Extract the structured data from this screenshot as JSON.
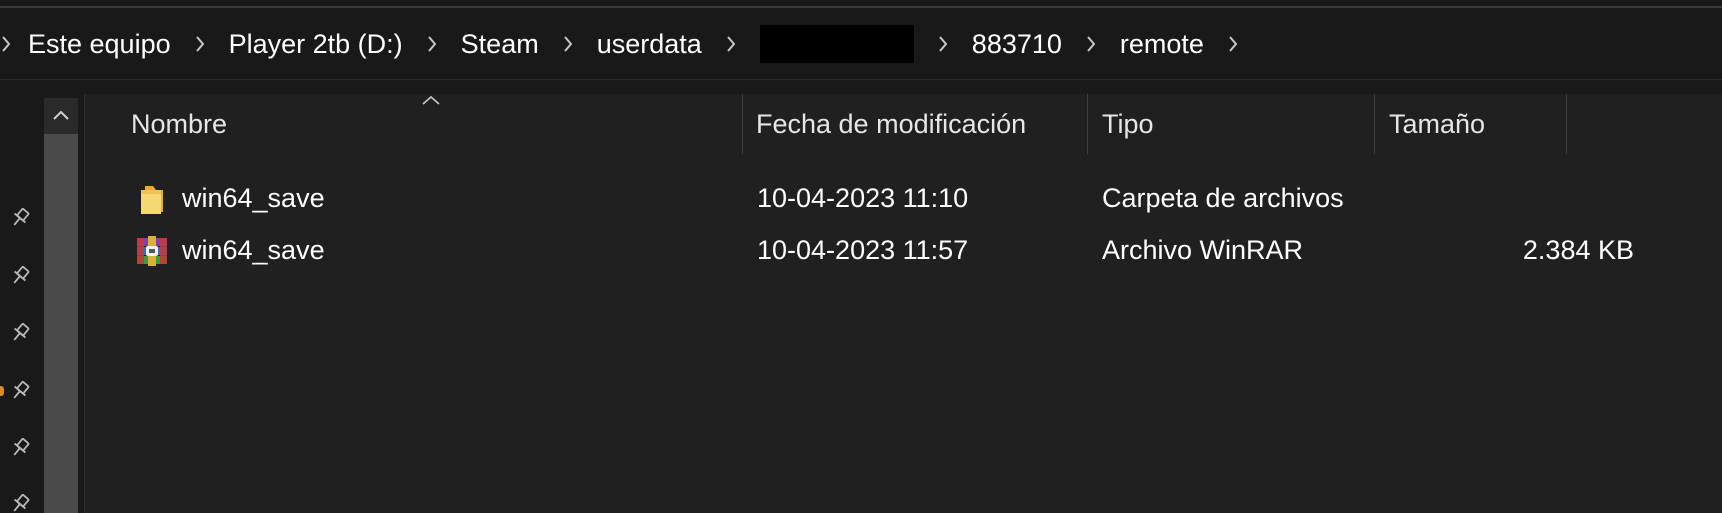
{
  "breadcrumb": {
    "items": [
      "Este equipo",
      "Player 2tb (D:)",
      "Steam",
      "userdata",
      "883710",
      "remote"
    ]
  },
  "columns": {
    "name": "Nombre",
    "modified": "Fecha de modificación",
    "type": "Tipo",
    "size": "Tamaño"
  },
  "files": [
    {
      "icon": "folder-icon",
      "name": "win64_save",
      "modified": "10-04-2023 11:10",
      "type": "Carpeta de archivos",
      "size": ""
    },
    {
      "icon": "winrar-archive-icon",
      "name": "win64_save",
      "modified": "10-04-2023 11:57",
      "type": "Archivo WinRAR",
      "size": "2.384 KB"
    }
  ],
  "colors": {
    "background": "#191919",
    "content_background": "#202020",
    "text": "#ffffff",
    "redacted": "#000000",
    "folder": "#f4c842"
  }
}
